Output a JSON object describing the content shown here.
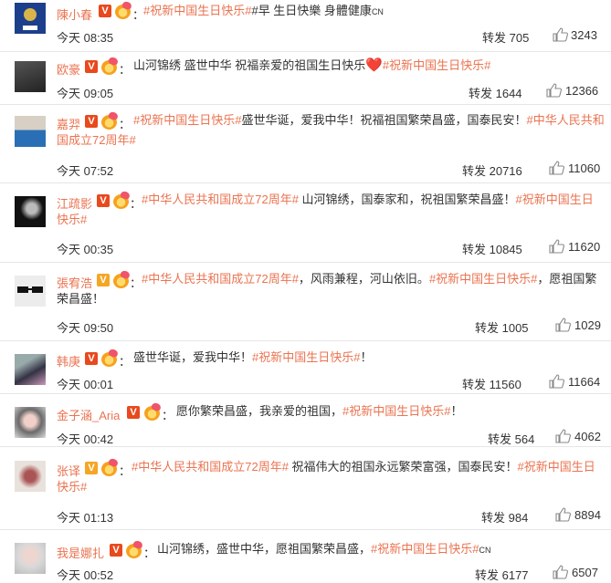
{
  "comments": [
    {
      "user": "陳小春",
      "segments": [
        {
          "t": "#祝新中国生日快乐#",
          "tag": true
        },
        {
          "t": "#早 生日快樂 身體健康",
          "tag": false
        }
      ],
      "suffix_cn": "CN",
      "time": "今天 08:35",
      "repost": "转发 705",
      "likes": "3243",
      "badge": "red"
    },
    {
      "user": "欧豪",
      "segments": [
        {
          "t": "山河锦绣 盛世中华 祝福亲爱的祖国生日快乐",
          "tag": false
        },
        {
          "t": "❤️",
          "heart": true
        },
        {
          "t": "#祝新中国生日快乐#",
          "tag": true
        }
      ],
      "time": "今天 09:05",
      "repost": "转发 1644",
      "likes": "12366",
      "badge": "red"
    },
    {
      "user": "嘉羿",
      "segments": [
        {
          "t": "#祝新中国生日快乐#",
          "tag": true
        },
        {
          "t": "盛世华诞，爱我中华！祝福祖国繁荣昌盛，国泰民安！",
          "tag": false
        },
        {
          "t": "#中华人民共和国成立72周年#",
          "tag": true
        }
      ],
      "time": "今天 07:52",
      "repost": "转发 20716",
      "likes": "11060",
      "badge": "red"
    },
    {
      "user": "江疏影",
      "segments": [
        {
          "t": "#中华人民共和国成立72周年#",
          "tag": true
        },
        {
          "t": " 山河锦绣，国泰家和，祝祖国繁荣昌盛！",
          "tag": false
        },
        {
          "t": "#祝新中国生日快乐#",
          "tag": true
        }
      ],
      "time": "今天 00:35",
      "repost": "转发 10845",
      "likes": "11620",
      "badge": "red"
    },
    {
      "user": "張宥浩",
      "segments": [
        {
          "t": "#中华人民共和国成立72周年#",
          "tag": true
        },
        {
          "t": "，风雨兼程，河山依旧。",
          "tag": false
        },
        {
          "t": "#祝新中国生日快乐#",
          "tag": true
        },
        {
          "t": "，愿祖国繁荣昌盛！",
          "tag": false
        }
      ],
      "time": "今天 09:50",
      "repost": "转发 1005",
      "likes": "1029",
      "badge": "gold"
    },
    {
      "user": "韩庚",
      "segments": [
        {
          "t": "盛世华诞，爱我中华！",
          "tag": false
        },
        {
          "t": "#祝新中国生日快乐#",
          "tag": true
        },
        {
          "t": "！",
          "tag": false
        }
      ],
      "time": "今天 00:01",
      "repost": "转发 11560",
      "likes": "11664",
      "badge": "red"
    },
    {
      "user": "金子涵_Aria",
      "segments": [
        {
          "t": "愿你繁荣昌盛，我亲爱的祖国，",
          "tag": false
        },
        {
          "t": "#祝新中国生日快乐#",
          "tag": true
        },
        {
          "t": "！",
          "tag": false
        }
      ],
      "time": "今天 00:42",
      "repost": "转发 564",
      "likes": "4062",
      "badge": "red"
    },
    {
      "user": "张译",
      "segments": [
        {
          "t": "#中华人民共和国成立72周年#",
          "tag": true
        },
        {
          "t": " 祝福伟大的祖国永远繁荣富强，国泰民安！",
          "tag": false
        },
        {
          "t": "#祝新中国生日快乐#",
          "tag": true
        }
      ],
      "time": "今天 01:13",
      "repost": "转发 984",
      "likes": "8894",
      "badge": "gold"
    },
    {
      "user": "我是娜扎",
      "segments": [
        {
          "t": "山河锦绣，盛世中华，愿祖国繁荣昌盛，",
          "tag": false
        },
        {
          "t": "#祝新中国生日快乐#",
          "tag": true
        }
      ],
      "suffix_cn": "CN",
      "time": "今天 00:52",
      "repost": "转发 6177",
      "likes": "6507",
      "badge": "red"
    }
  ],
  "colors": {
    "name": "#eb7350",
    "tag": "#eb7350",
    "text": "#333333",
    "badge_red": "#e8491d",
    "badge_gold": "#f5a623"
  },
  "icons": {
    "like": "thumbs-up-icon",
    "vip": "v-badge-icon",
    "fan": "fan-badge-icon"
  }
}
